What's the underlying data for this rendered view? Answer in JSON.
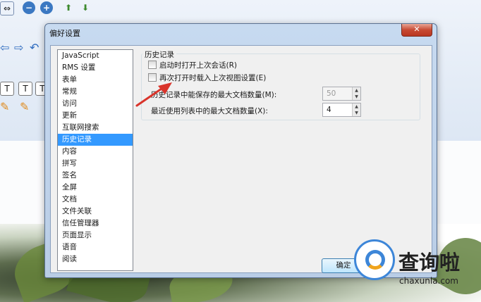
{
  "dialog": {
    "title": "偏好设置",
    "close_glyph": "✕",
    "categories": [
      {
        "label": "JavaScript"
      },
      {
        "label": "RMS 设置"
      },
      {
        "label": "表单"
      },
      {
        "label": "常规"
      },
      {
        "label": "访问"
      },
      {
        "label": "更新"
      },
      {
        "label": "互联网搜索"
      },
      {
        "label": "历史记录",
        "selected": true
      },
      {
        "label": "内容"
      },
      {
        "label": "拼写"
      },
      {
        "label": "签名"
      },
      {
        "label": "全屏"
      },
      {
        "label": "文档"
      },
      {
        "label": "文件关联"
      },
      {
        "label": "信任管理器"
      },
      {
        "label": "页面显示"
      },
      {
        "label": "语音"
      },
      {
        "label": "阅读"
      }
    ],
    "history": {
      "group_title": "历史记录",
      "open_last_session": {
        "label": "启动时打开上次会话(R)",
        "checked": false
      },
      "restore_view_settings": {
        "label": "再次打开时载入上次视图设置(E)",
        "checked": false
      },
      "max_saved_docs": {
        "label": "历史记录中能保存的最大文档数量(M):",
        "value": "50",
        "enabled": false
      },
      "max_recent_docs": {
        "label": "最近使用列表中的最大文档数量(X):",
        "value": "4",
        "enabled": true
      }
    },
    "ok_label": "确定"
  },
  "watermark": {
    "title": "查询啦",
    "url": "chaxunla.com"
  },
  "colors": {
    "selection": "#3399ff",
    "close_button": "#c74a33",
    "annotation_arrow": "#d9342b"
  }
}
